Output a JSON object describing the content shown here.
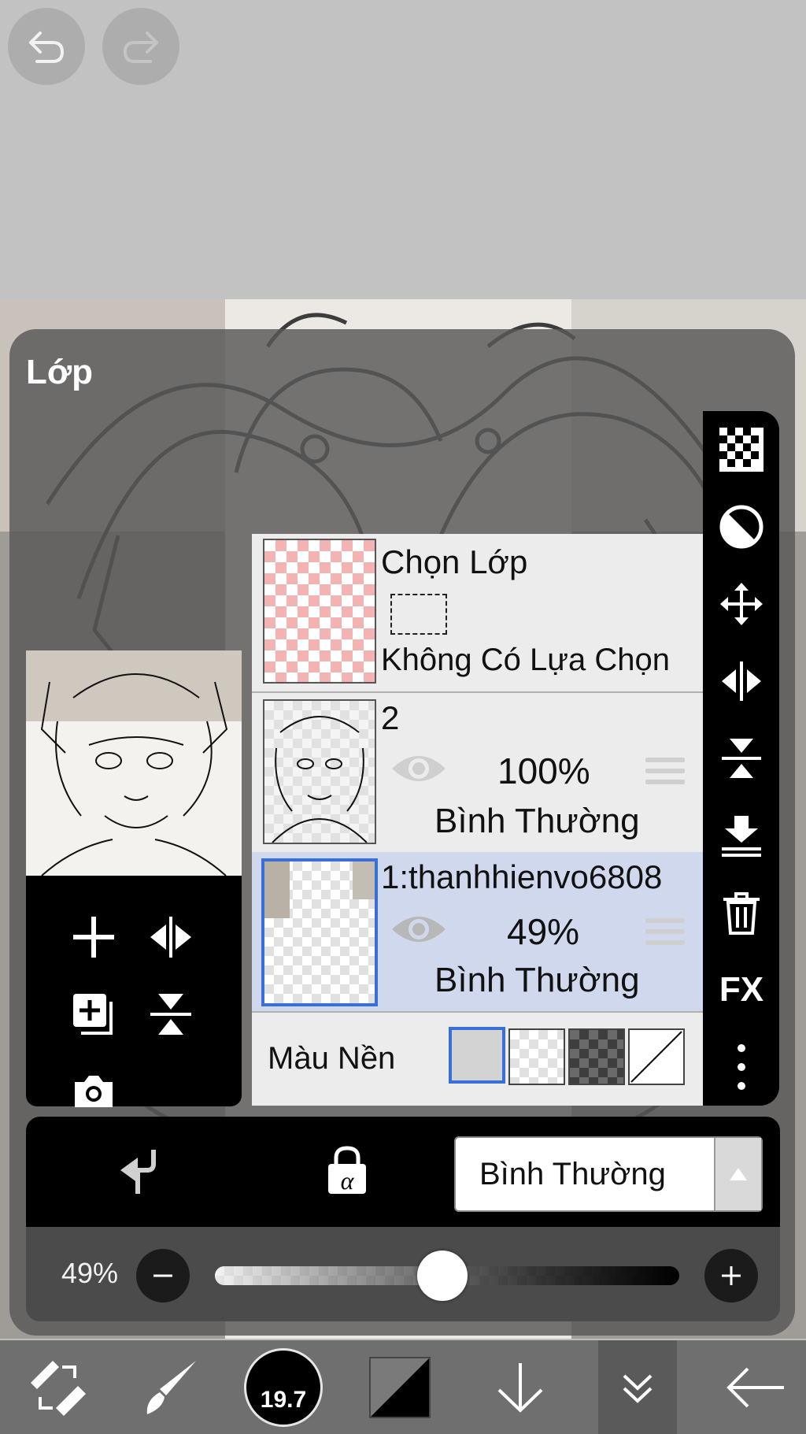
{
  "toolbar_top": {
    "undo_icon": "undo-icon",
    "redo_icon": "redo-icon"
  },
  "panel": {
    "title": "Lớp"
  },
  "layers": [
    {
      "name": "Chọn Lớp",
      "status": "Không Có Lựa Chọn"
    },
    {
      "name": "2",
      "opacity": "100%",
      "blend": "Bình Thường"
    },
    {
      "name": "1:thanhhienvo6808",
      "opacity": "49%",
      "blend": "Bình Thường",
      "selected": true
    }
  ],
  "background": {
    "label": "Màu Nền",
    "options": [
      "light-grey",
      "transparent-checker",
      "dark-checker",
      "none"
    ],
    "selected": "light-grey"
  },
  "right_tools": [
    "checker-icon",
    "contrast-icon",
    "move-icon",
    "flip-horizontal-icon",
    "flip-vertical-icon",
    "merge-down-icon",
    "trash-icon",
    "fx-icon",
    "more-icon"
  ],
  "fx_label": "FX",
  "blend_bar": {
    "clip_icon": "clip-arrow-icon",
    "alpha_lock_icon": "alpha-lock-icon",
    "blend_mode": "Bình Thường"
  },
  "opacity": {
    "label": "49%",
    "value": 0.49
  },
  "bottom_toolbar": {
    "brush_size": "19.7",
    "items": [
      "transform-icon",
      "brush-icon",
      "brush-size",
      "color-swatch",
      "down-arrow-icon",
      "layers-collapse-icon",
      "back-arrow-icon"
    ]
  },
  "colors": {
    "accent": "#3a6fd8",
    "selected_row": "#cfd8ec",
    "panel": "#585858"
  }
}
